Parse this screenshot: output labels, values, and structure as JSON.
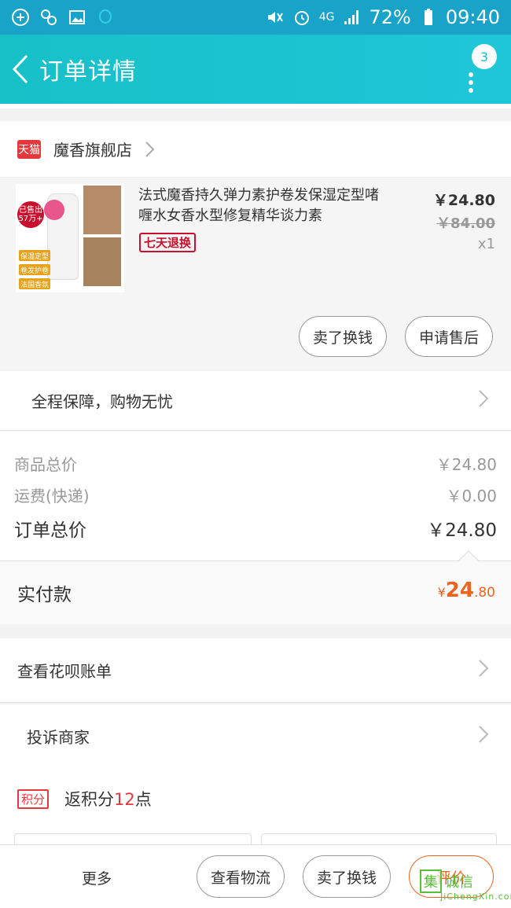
{
  "status_bar": {
    "left_icons": [
      "add-circle-icon",
      "eight-icon",
      "image-icon",
      "qq-icon"
    ],
    "right_icons": [
      "mute-icon",
      "alarm-icon",
      "network-4g-icon",
      "signal-icon",
      "battery-icon"
    ],
    "network": "4G",
    "battery": "72%",
    "time": "09:40"
  },
  "header": {
    "title": "订单详情",
    "badge_count": "3",
    "accent": "#1ec6d8"
  },
  "shop": {
    "platform_tag": "天猫",
    "name": "魔香旗舰店"
  },
  "product": {
    "title": "法式魔香持久弹力素护卷发保湿定型啫喱水女香水型修复精华谈力素",
    "badge": "七天退换",
    "price": "￥24.80",
    "original_price": "￥84.00",
    "quantity": "x1",
    "image_labels": [
      "已售出",
      "57万+",
      "保湿定型",
      "卷发护卷",
      "法国香氛"
    ]
  },
  "actions": {
    "sell": "卖了换钱",
    "after_sale": "申请售后"
  },
  "guarantee": {
    "label": "全程保障，购物无忧"
  },
  "totals": {
    "goods_label": "商品总价",
    "goods_value": "￥24.80",
    "shipping_label": "运费(快递)",
    "shipping_value": "￥0.00",
    "order_label": "订单总价",
    "order_value": "￥24.80"
  },
  "payment": {
    "label": "实付款",
    "currency": "¥",
    "integer": "24",
    "decimal": ".80",
    "color": "#f0631f"
  },
  "list": {
    "huabei": "查看花呗账单",
    "complaint": "投诉商家",
    "points_tag": "积分",
    "points_prefix": "返积分",
    "points_value": "12",
    "points_suffix": "点"
  },
  "bottom_bar": {
    "more": "更多",
    "logistics": "查看物流",
    "sell": "卖了换钱",
    "review": "评价"
  },
  "watermark": {
    "char": "集",
    "text": "诚信",
    "sub": "JiChengXin.com"
  }
}
